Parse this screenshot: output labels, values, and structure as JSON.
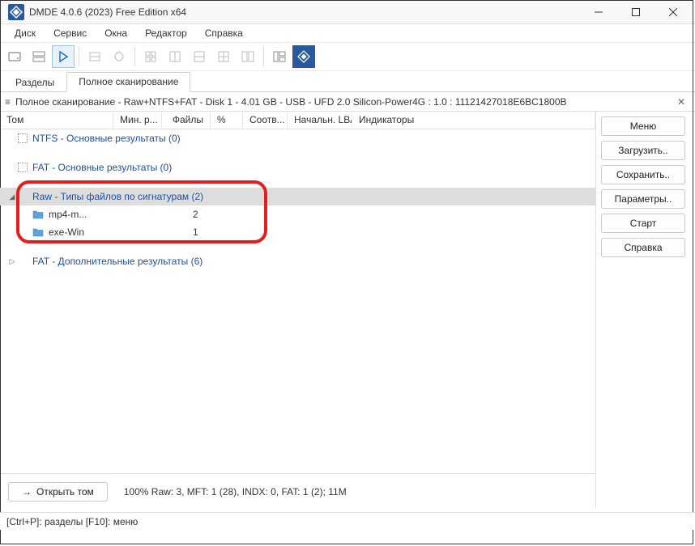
{
  "window": {
    "title": "DMDE 4.0.6 (2023) Free Edition x64"
  },
  "menu": {
    "items": [
      "Диск",
      "Сервис",
      "Окна",
      "Редактор",
      "Справка"
    ]
  },
  "tabs": {
    "items": [
      "Разделы",
      "Полное сканирование"
    ],
    "active": 1
  },
  "info": {
    "text": "Полное сканирование - Raw+NTFS+FAT - Disk 1 - 4.01 GB - USB - UFD 2.0 Silicon-Power4G : 1.0 : 11121427018E6BC1800B"
  },
  "columns": {
    "tom": "Том",
    "min": "Мин. р...",
    "files": "Файлы",
    "pct": "%",
    "soot": "Соотв...",
    "lba": "Начальн. LBA",
    "ind": "Индикаторы"
  },
  "tree": {
    "ntfs": "NTFS - Основные результаты (0)",
    "fat": "FAT - Основные результаты (0)",
    "raw": "Raw - Типы файлов по сигнатурам (2)",
    "raw_item1": {
      "name": "mp4-m...",
      "count": "2"
    },
    "raw_item2": {
      "name": "exe-Win",
      "count": "1"
    },
    "fat_extra": "FAT - Дополнительные результаты (6)"
  },
  "sidebar": {
    "menu": "Меню",
    "load": "Загрузить..",
    "save": "Сохранить..",
    "params": "Параметры..",
    "start": "Старт",
    "help": "Справка"
  },
  "bottom": {
    "open": "Открыть том",
    "stats": "100% Raw: 3, MFT: 1 (28), INDX: 0, FAT: 1 (2); 11M"
  },
  "status": {
    "text": "[Ctrl+P]: разделы  [F10]: меню"
  }
}
